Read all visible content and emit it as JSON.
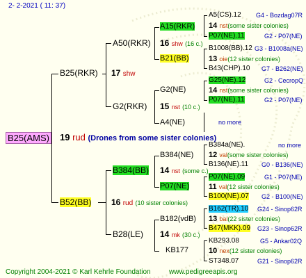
{
  "header": {
    "date": "2-  2-2021 ( 11: 37)"
  },
  "root": {
    "label": "B25(AMS)",
    "number": "19",
    "code": "rud",
    "note": "(Drones from some sister colonies)"
  },
  "gen1": {
    "sire": {
      "label": "B25(RKR)",
      "number": "17",
      "code": "shw"
    },
    "dam": {
      "label": "B52(BB)",
      "number": "16",
      "code": "rud",
      "note": "(10 sister colonies)"
    }
  },
  "gen2": {
    "a": {
      "label": "A50(RKR)",
      "number": "16",
      "code": "shw",
      "note": "(16 c.)"
    },
    "b": {
      "label": "G2(RKR)",
      "number": "15",
      "code": "nst",
      "note": "(10 c.)"
    },
    "c": {
      "label": "B384(BB)",
      "number": "14",
      "code": "nst",
      "note": "(some c.)"
    },
    "d": {
      "label": "B28(LE)",
      "number": "14",
      "code": "mk",
      "note": "(30 c.)"
    }
  },
  "gen3": {
    "a1": "A15(RKR)",
    "a2": "B21(BB)",
    "b1": "G2(NE)",
    "b2": "A4(NE)",
    "c1": "B384(NE)",
    "c2": "P07(NE)",
    "d1": "B182(vdB)",
    "d2": "KB177"
  },
  "gen4": [
    {
      "name": "A5(CS).12",
      "ref": "G4 - Bozdag07R"
    },
    {
      "number": "14",
      "code": "nst",
      "note": "(some sister colonies)"
    },
    {
      "name": "P07(NE).11",
      "ref": "G2 - P07(NE)"
    },
    {
      "name": "B1008(BB).12",
      "ref": "G3 - B1008a(NE)"
    },
    {
      "number": "13",
      "code": "oie",
      "note": "(12 sister colonies)"
    },
    {
      "name": "B43(CHP).10",
      "ref": "G7 - B262(NE)"
    },
    {
      "name": "G25(NE).12",
      "ref": "G2 - CecropQ"
    },
    {
      "number": "14",
      "code": "nst",
      "note": "(some sister colonies)"
    },
    {
      "name": "P07(NE).11",
      "ref": "G2 - P07(NE)"
    },
    {
      "more": "no more"
    },
    {
      "name": "B384a(NE).",
      "ref": "no more"
    },
    {
      "number": "12",
      "code": "val",
      "note": "(some sister colonies)"
    },
    {
      "name": "B136(NE).11",
      "ref": "G0 - B136(NE)"
    },
    {
      "name": "P07(NE).09",
      "ref": "G1 - P07(NE)"
    },
    {
      "number": "11",
      "code": "val",
      "note": "(12 sister colonies)"
    },
    {
      "name": "B100(NE).07",
      "ref": "G2 - B100(NE)"
    },
    {
      "name": "B162(TR).10",
      "ref": "G24 - Sinop62R"
    },
    {
      "number": "13",
      "code": "bal",
      "note": "(22 sister colonies)"
    },
    {
      "name": "B47(MKK).09",
      "ref": "G23 - Sinop62R"
    },
    {
      "name": "KB293.08",
      "ref": "G5 - Ankar02Q"
    },
    {
      "number": "10",
      "code": "nex",
      "note": "(12 sister colonies)"
    },
    {
      "name": "ST348.07",
      "ref": "G21 - Sinop62R"
    }
  ],
  "footer": {
    "copyright": "Copyright 2004-2021 © Karl Kehrle Foundation",
    "site": "www.pedigreeapis.org"
  }
}
